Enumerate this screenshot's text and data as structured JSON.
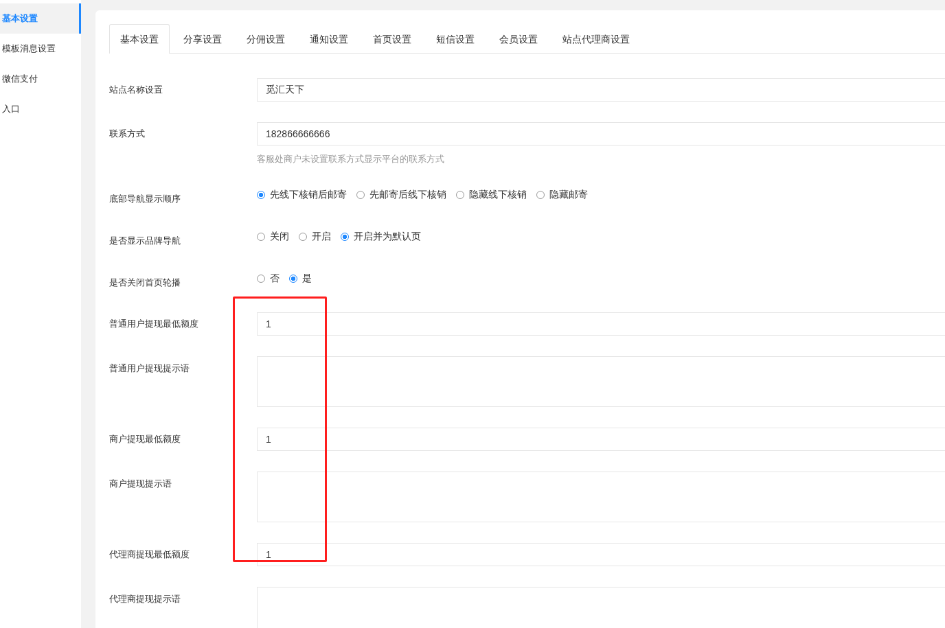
{
  "sidebar": {
    "items": [
      {
        "label": "基本设置",
        "selected": true
      },
      {
        "label": "模板消息设置",
        "selected": false
      },
      {
        "label": "微信支付",
        "selected": false
      },
      {
        "label": "入口",
        "selected": false
      }
    ]
  },
  "tabs": [
    {
      "label": "基本设置",
      "selected": true
    },
    {
      "label": "分享设置",
      "selected": false
    },
    {
      "label": "分佣设置",
      "selected": false
    },
    {
      "label": "通知设置",
      "selected": false
    },
    {
      "label": "首页设置",
      "selected": false
    },
    {
      "label": "短信设置",
      "selected": false
    },
    {
      "label": "会员设置",
      "selected": false
    },
    {
      "label": "站点代理商设置",
      "selected": false
    }
  ],
  "form": [
    {
      "kind": "text",
      "label": "站点名称设置",
      "value": "觅汇天下"
    },
    {
      "kind": "text",
      "label": "联系方式",
      "value": "182866666666",
      "hint": "客服处商户未设置联系方式显示平台的联系方式"
    },
    {
      "kind": "radio",
      "label": "底部导航显示顺序",
      "options": [
        {
          "label": "先线下核销后邮寄",
          "selected": true
        },
        {
          "label": "先邮寄后线下核销",
          "selected": false
        },
        {
          "label": "隐藏线下核销",
          "selected": false
        },
        {
          "label": "隐藏邮寄",
          "selected": false
        }
      ]
    },
    {
      "kind": "radio",
      "label": "是否显示品牌导航",
      "options": [
        {
          "label": "关闭",
          "selected": false
        },
        {
          "label": "开启",
          "selected": false
        },
        {
          "label": "开启并为默认页",
          "selected": true
        }
      ]
    },
    {
      "kind": "radio",
      "label": "是否关闭首页轮播",
      "options": [
        {
          "label": "否",
          "selected": false
        },
        {
          "label": "是",
          "selected": true
        }
      ]
    },
    {
      "kind": "text",
      "label": "普通用户提现最低额度",
      "value": "1"
    },
    {
      "kind": "textarea",
      "label": "普通用户提现提示语"
    },
    {
      "kind": "text",
      "label": "商户提现最低额度",
      "value": "1"
    },
    {
      "kind": "textarea",
      "label": "商户提现提示语"
    },
    {
      "kind": "text",
      "label": "代理商提现最低额度",
      "value": "1"
    },
    {
      "kind": "textarea",
      "label": "代理商提现提示语"
    }
  ],
  "highlight_box": true
}
